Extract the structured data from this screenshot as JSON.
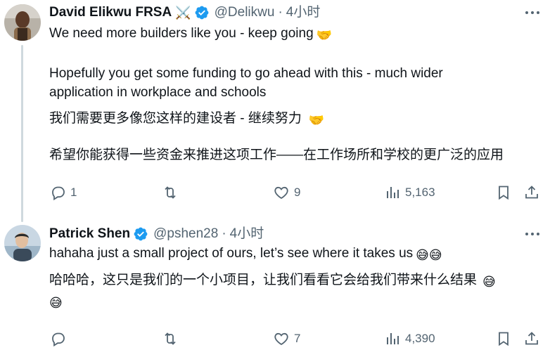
{
  "tweets": [
    {
      "author_name": "David Elikwu FRSA",
      "author_emoji": "⚔️",
      "handle": "@Delikwu",
      "separator": "·",
      "time": "4小时",
      "text_line1": "We need more builders like you - keep going",
      "text_line1_emoji": "🤝",
      "text_line2": "Hopefully you get some funding to go ahead with this - much wider",
      "text_line3": "application in workplace and schools",
      "text_line4": "我们需要更多像您这样的建设者 - 继续努力",
      "text_line4_emoji": "🤝",
      "text_line5": "希望你能获得一些资金来推进这项工作——在工作场所和学校的更广泛的应用",
      "replies": "1",
      "retweets": "",
      "likes": "9",
      "views": "5,163"
    },
    {
      "author_name": "Patrick Shen",
      "handle": "@pshen28",
      "separator": "·",
      "time": "4小时",
      "text_line1": "hahaha just a small project of ours, let’s see where it takes us",
      "text_line1_emoji": "😅😅",
      "text_line2": "哈哈哈，这只是我们的一个小项目，让我们看看它会给我们带来什么结果",
      "text_line2_emoji": "😅",
      "text_line3_emoji": "😅",
      "replies": "",
      "retweets": "",
      "likes": "7",
      "views": "4,390"
    }
  ],
  "colors": {
    "text": "#0f1419",
    "secondary": "#536471",
    "verified": "#1d9bf0",
    "thread_line": "#cfd9de"
  }
}
